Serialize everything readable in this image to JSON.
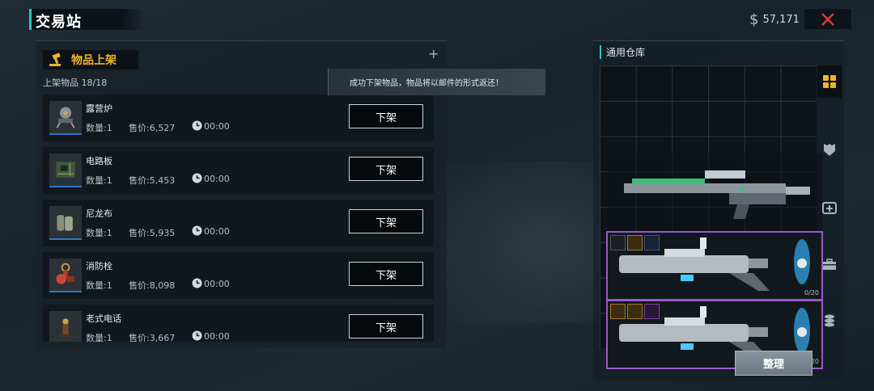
{
  "header": {
    "title": "交易站",
    "currency_symbol": "$",
    "money": "57,171"
  },
  "listing": {
    "section_title": "物品上架",
    "count_label": "上架物品 18/18",
    "items": [
      {
        "name": "露营炉",
        "qty": "数量:1",
        "price": "售价:6,527",
        "time": "00:00",
        "action": "下架",
        "icon": "camping-stove-icon"
      },
      {
        "name": "电路板",
        "qty": "数量:1",
        "price": "售价:5,453",
        "time": "00:00",
        "action": "下架",
        "icon": "circuit-board-icon"
      },
      {
        "name": "尼龙布",
        "qty": "数量:1",
        "price": "售价:5,935",
        "time": "00:00",
        "action": "下架",
        "icon": "nylon-cloth-icon"
      },
      {
        "name": "消防栓",
        "qty": "数量:1",
        "price": "售价:8,098",
        "time": "00:00",
        "action": "下架",
        "icon": "fire-hydrant-icon"
      },
      {
        "name": "老式电话",
        "qty": "数量:1",
        "price": "售价:3,667",
        "time": "00:00",
        "action": "下架",
        "icon": "old-telephone-icon"
      }
    ]
  },
  "toast": {
    "message": "成功下架物品，物品将以邮件的形式返还！"
  },
  "warehouse": {
    "title": "通用仓库",
    "ammo_1": "0/20",
    "ammo_2": "0/20",
    "sort_button": "整理",
    "tabs": [
      "grid-icon",
      "armor-icon",
      "medkit-icon",
      "toolbox-icon",
      "coins-icon"
    ]
  },
  "colors": {
    "accent": "#2fc6c0",
    "gold": "#f0b429",
    "rare_purple": "#9b57c9",
    "close_red": "#e03a3a"
  }
}
